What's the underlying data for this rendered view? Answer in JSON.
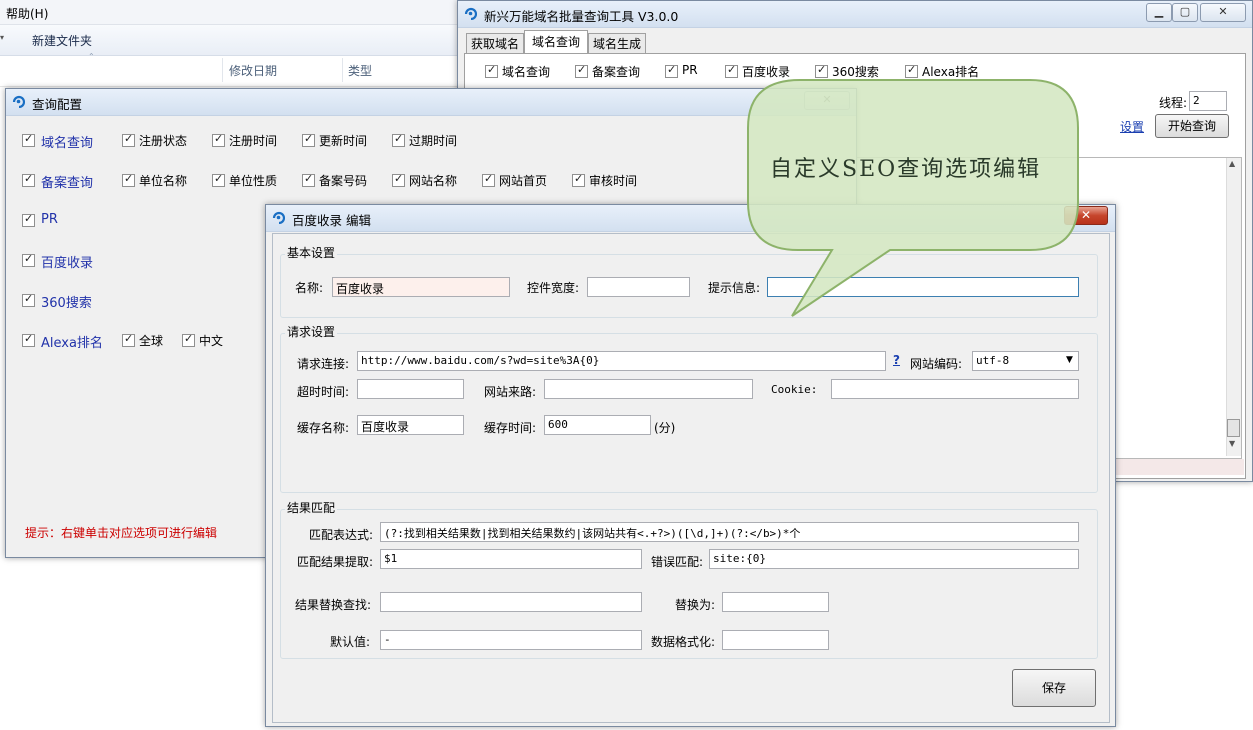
{
  "explorer": {
    "menu_help": "帮助(H)",
    "new_folder": "新建文件夹",
    "col_date": "修改日期",
    "col_type": "类型"
  },
  "main_window": {
    "title": "新兴万能域名批量查询工具 V3.0.0",
    "tabs": [
      "获取域名",
      "域名查询",
      "域名生成"
    ],
    "options": [
      "域名查询",
      "备案查询",
      "PR",
      "百度收录",
      "360搜索",
      "Alexa排名"
    ],
    "threads_label": "线程:",
    "threads_value": "2",
    "settings_link": "设置",
    "start_button": "开始查询"
  },
  "query_config": {
    "title": "查询配置",
    "rows": [
      {
        "main": "域名查询",
        "subs": [
          "注册状态",
          "注册时间",
          "更新时间",
          "过期时间"
        ]
      },
      {
        "main": "备案查询",
        "subs": [
          "单位名称",
          "单位性质",
          "备案号码",
          "网站名称",
          "网站首页",
          "审核时间"
        ]
      },
      {
        "main": "PR",
        "subs": []
      },
      {
        "main": "百度收录",
        "subs": []
      },
      {
        "main": "360搜索",
        "subs": []
      },
      {
        "main": "Alexa排名",
        "subs": [
          "全球",
          "中文"
        ]
      }
    ],
    "hint": "提示：右键单击对应选项可进行编辑"
  },
  "edit_dialog": {
    "title": "百度收录 编辑",
    "basic": {
      "group": "基本设置",
      "name_label": "名称:",
      "name_value": "百度收录",
      "width_label": "控件宽度:",
      "width_value": "",
      "tip_label": "提示信息:",
      "tip_value": ""
    },
    "request": {
      "group": "请求设置",
      "url_label": "请求连接:",
      "url_value": "http://www.baidu.com/s?wd=site%3A{0}",
      "help_link": "?",
      "encoding_label": "网站编码:",
      "encoding_value": "utf-8",
      "timeout_label": "超时时间:",
      "timeout_value": "",
      "referer_label": "网站来路:",
      "referer_value": "",
      "cookie_label": "Cookie:",
      "cookie_value": "",
      "cache_name_label": "缓存名称:",
      "cache_name_value": "百度收录",
      "cache_time_label": "缓存时间:",
      "cache_time_value": "600",
      "cache_time_unit": "(分)"
    },
    "match": {
      "group": "结果匹配",
      "regex_label": "匹配表达式:",
      "regex_value": "(?:找到相关结果数|找到相关结果数约|该网站共有<.+?>)([\\d,]+)(?:</b>)*个",
      "extract_label": "匹配结果提取:",
      "extract_value": "$1",
      "error_label": "错误匹配:",
      "error_value": "site:{0}",
      "replace_find_label": "结果替换查找:",
      "replace_find_value": "",
      "replace_with_label": "替换为:",
      "replace_with_value": "",
      "default_label": "默认值:",
      "default_value": "-",
      "format_label": "数据格式化:",
      "format_value": ""
    },
    "save_button": "保存",
    "close_symbol": "✕"
  },
  "callout": {
    "text": "自定义SEO查询选项编辑"
  },
  "colors": {
    "link_blue": "#2233aa",
    "hint_red": "#cc0000",
    "bubble_fill": "#d4e7c2",
    "bubble_border": "#8db36a"
  }
}
